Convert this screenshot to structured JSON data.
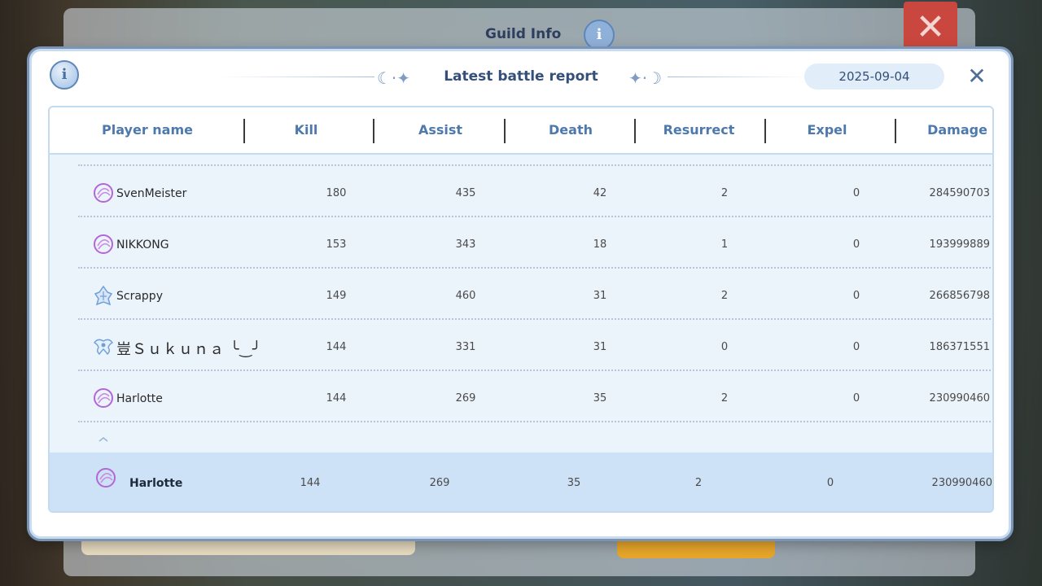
{
  "background": {
    "guild_title": "Guild Info",
    "close_glyph": "✕",
    "info_glyph": "i"
  },
  "dialog": {
    "title": "Latest battle report",
    "date": "2025-09-04",
    "info_glyph": "i",
    "close_glyph": "✕",
    "moon_left": "☾·✦",
    "moon_right": "✦·☽"
  },
  "table": {
    "headers": [
      "Player name",
      "Kill",
      "Assist",
      "Death",
      "Resurrect",
      "Expel",
      "Damage"
    ],
    "rows": [
      {
        "name": "SvenMeister",
        "icon": "purple-emblem-icon",
        "kill": "180",
        "assist": "435",
        "death": "42",
        "resurrect": "2",
        "expel": "0",
        "damage": "284590703"
      },
      {
        "name": "NIKKONG",
        "icon": "purple-emblem-icon",
        "kill": "153",
        "assist": "343",
        "death": "18",
        "resurrect": "1",
        "expel": "0",
        "damage": "193999889"
      },
      {
        "name": "Scrappy",
        "icon": "blue-crystal-icon",
        "kill": "149",
        "assist": "460",
        "death": "31",
        "resurrect": "2",
        "expel": "0",
        "damage": "266856798"
      },
      {
        "name": "豈Ｓｕｋｕｎａ ╰‿╯",
        "icon": "blue-wings-icon",
        "kill": "144",
        "assist": "331",
        "death": "31",
        "resurrect": "0",
        "expel": "0",
        "damage": "186371551"
      },
      {
        "name": "Harlotte",
        "icon": "purple-emblem-icon",
        "kill": "144",
        "assist": "269",
        "death": "35",
        "resurrect": "2",
        "expel": "0",
        "damage": "230990460"
      }
    ],
    "self_row": {
      "name": "Harlotte",
      "icon": "purple-emblem-icon",
      "kill": "144",
      "assist": "269",
      "death": "35",
      "resurrect": "2",
      "expel": "0",
      "damage": "230990460"
    }
  },
  "colors": {
    "accent": "#4e79ad",
    "self_row": "#cde2f6",
    "emblem_purple": "#b266d8",
    "emblem_blue": "#6f9fd8"
  }
}
